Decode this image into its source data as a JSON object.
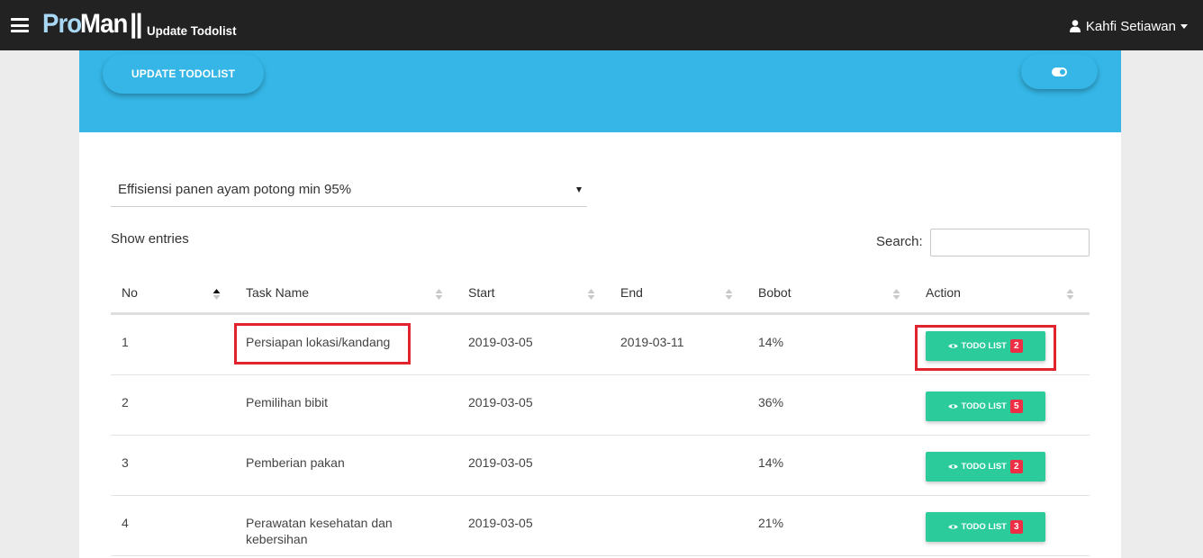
{
  "navbar": {
    "brand_pro": "Pro",
    "brand_man": "Man",
    "brand_sep": "||",
    "page_subtitle": "Update Todolist",
    "user_name": "Kahfi Setiawan"
  },
  "header": {
    "update_button_label": "UPDATE TODOLIST"
  },
  "filter": {
    "selected_goal": "Effisiensi panen ayam potong min 95%"
  },
  "table_controls": {
    "show_entries_label": "Show entries",
    "search_label": "Search:",
    "search_value": ""
  },
  "table": {
    "columns": [
      "No",
      "Task Name",
      "Start",
      "End",
      "Bobot",
      "Action"
    ],
    "sorted_column": "No",
    "sort_direction": "ascending",
    "rows": [
      {
        "no": "1",
        "task": "Persiapan lokasi/kandang",
        "start": "2019-03-05",
        "end": "2019-03-11",
        "bobot": "14%",
        "action_label": "TODO LIST",
        "badge": "2"
      },
      {
        "no": "2",
        "task": "Pemilihan bibit",
        "start": "2019-03-05",
        "end": "",
        "bobot": "36%",
        "action_label": "TODO LIST",
        "badge": "5"
      },
      {
        "no": "3",
        "task": "Pemberian pakan",
        "start": "2019-03-05",
        "end": "",
        "bobot": "14%",
        "action_label": "TODO LIST",
        "badge": "2"
      },
      {
        "no": "4",
        "task": "Perawatan kesehatan dan kebersihan",
        "start": "2019-03-05",
        "end": "",
        "bobot": "21%",
        "action_label": "TODO LIST",
        "badge": "3"
      }
    ]
  },
  "colors": {
    "navbar": "#222222",
    "header_band": "#35b6e6",
    "todo_button": "#2bcb9c",
    "badge": "#ee2e45",
    "highlight": "#e0232d"
  },
  "icons": {
    "menu": "hamburger-icon",
    "user": "user-icon",
    "toggle": "toggle-icon",
    "view": "eye-icon",
    "sort": "sort-icon"
  }
}
